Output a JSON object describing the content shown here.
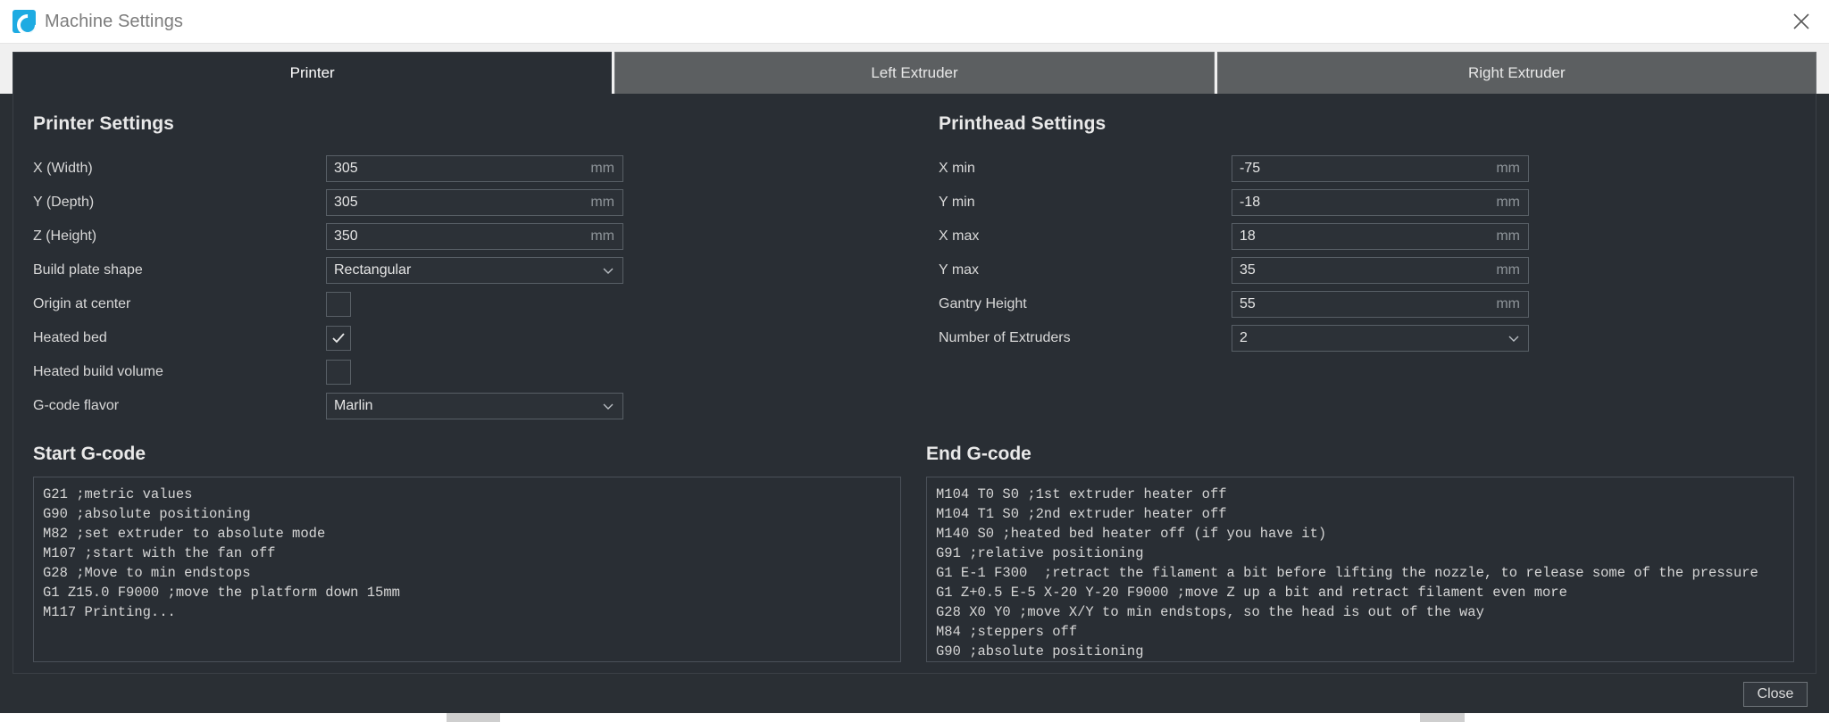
{
  "window": {
    "title": "Machine Settings",
    "logo_icon": "cura-logo-icon",
    "close_icon": "close-icon"
  },
  "tabs": [
    {
      "label": "Printer",
      "active": true
    },
    {
      "label": "Left Extruder",
      "active": false
    },
    {
      "label": "Right Extruder",
      "active": false
    }
  ],
  "printer_settings": {
    "heading": "Printer Settings",
    "rows": [
      {
        "label": "X (Width)",
        "type": "text",
        "value": "305",
        "unit": "mm"
      },
      {
        "label": "Y (Depth)",
        "type": "text",
        "value": "305",
        "unit": "mm"
      },
      {
        "label": "Z (Height)",
        "type": "text",
        "value": "350",
        "unit": "mm"
      },
      {
        "label": "Build plate shape",
        "type": "select",
        "value": "Rectangular",
        "unit": ""
      },
      {
        "label": "Origin at center",
        "type": "checkbox",
        "value": "",
        "checked": false
      },
      {
        "label": "Heated bed",
        "type": "checkbox",
        "value": "",
        "checked": true
      },
      {
        "label": "Heated build volume",
        "type": "checkbox",
        "value": "",
        "checked": false
      },
      {
        "label": "G-code flavor",
        "type": "select",
        "value": "Marlin",
        "unit": ""
      }
    ]
  },
  "printhead_settings": {
    "heading": "Printhead Settings",
    "rows": [
      {
        "label": "X min",
        "type": "text",
        "value": "-75",
        "unit": "mm"
      },
      {
        "label": "Y min",
        "type": "text",
        "value": "-18",
        "unit": "mm"
      },
      {
        "label": "X max",
        "type": "text",
        "value": "18",
        "unit": "mm"
      },
      {
        "label": "Y max",
        "type": "text",
        "value": "35",
        "unit": "mm"
      },
      {
        "label": "Gantry Height",
        "type": "text",
        "value": "55",
        "unit": "mm"
      },
      {
        "label": "Number of Extruders",
        "type": "select",
        "value": "2",
        "unit": ""
      }
    ]
  },
  "start_gcode": {
    "heading": "Start G-code",
    "text": "G21 ;metric values\nG90 ;absolute positioning\nM82 ;set extruder to absolute mode\nM107 ;start with the fan off\nG28 ;Move to min endstops\nG1 Z15.0 F9000 ;move the platform down 15mm\nM117 Printing..."
  },
  "end_gcode": {
    "heading": "End G-code",
    "text": "M104 T0 S0 ;1st extruder heater off\nM104 T1 S0 ;2nd extruder heater off\nM140 S0 ;heated bed heater off (if you have it)\nG91 ;relative positioning\nG1 E-1 F300  ;retract the filament a bit before lifting the nozzle, to release some of the pressure\nG1 Z+0.5 E-5 X-20 Y-20 F9000 ;move Z up a bit and retract filament even more\nG28 X0 Y0 ;move X/Y to min endstops, so the head is out of the way\nM84 ;steppers off\nG90 ;absolute positioning"
  },
  "footer": {
    "close_label": "Close"
  },
  "colors": {
    "accent": "#1eabe2",
    "panel_bg": "#292e34",
    "tab_inactive": "#5c5f61",
    "titlebar_bg": "#ffffff"
  }
}
